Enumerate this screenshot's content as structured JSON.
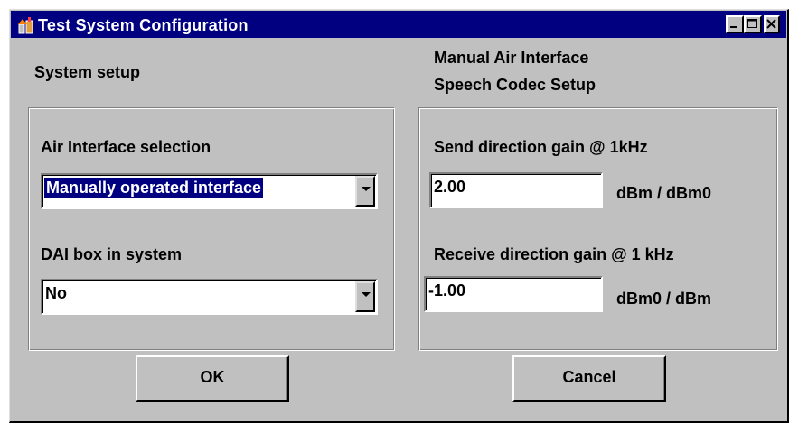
{
  "window": {
    "title": "Test System Configuration",
    "controls": {
      "minimize": "minimize",
      "maximize": "maximize",
      "close": "close"
    }
  },
  "system_setup": {
    "heading": "System setup",
    "air_interface_label": "Air Interface selection",
    "air_interface_value": "Manually operated interface",
    "dai_label": "DAI box in system",
    "dai_value": "No"
  },
  "codec_setup": {
    "heading_line1": "Manual Air Interface",
    "heading_line2": "Speech Codec Setup",
    "send_label": "Send direction gain @ 1kHz",
    "send_value": "2.00",
    "send_unit": "dBm / dBm0",
    "receive_label": "Receive direction gain @ 1 kHz",
    "receive_value": "-1.00",
    "receive_unit": "dBm0 / dBm"
  },
  "buttons": {
    "ok": "OK",
    "cancel": "Cancel"
  },
  "colors": {
    "titlebar": "#000080",
    "face": "#c0c0c0",
    "selection": "#000080"
  }
}
